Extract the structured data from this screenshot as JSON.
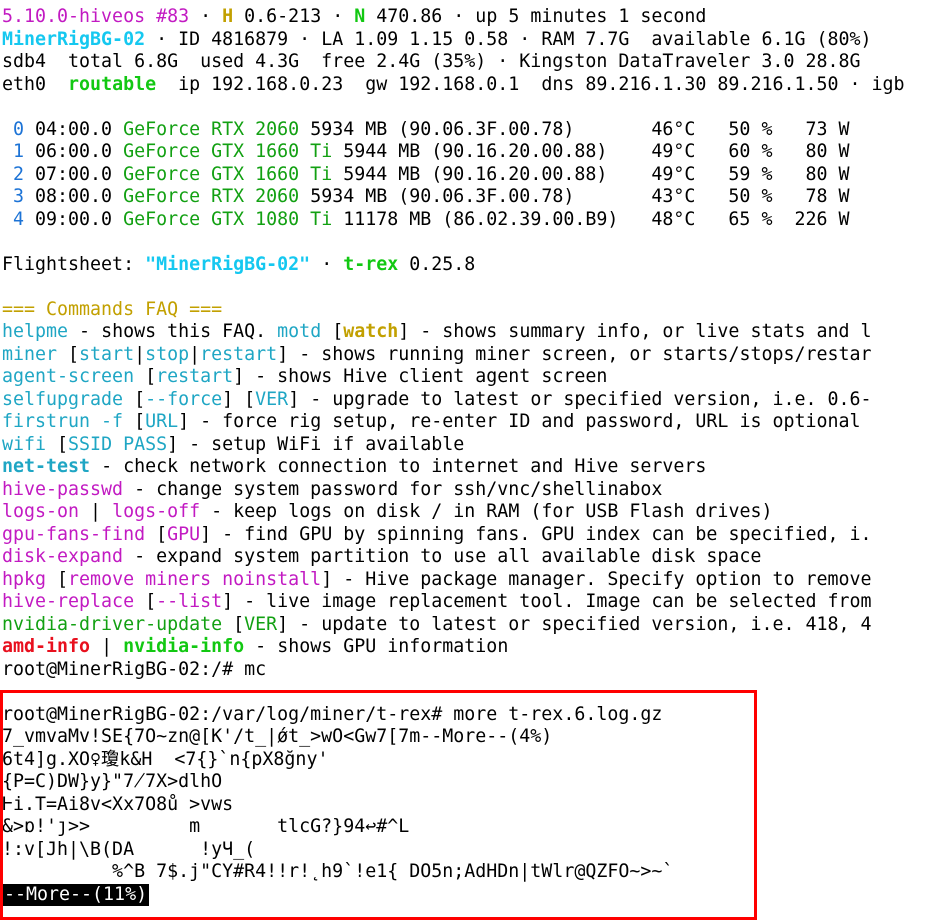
{
  "lines": [
    [
      [
        "5.10.0-hiveos #83",
        "c-magenta"
      ],
      [
        " · ",
        ""
      ],
      [
        "H",
        "c-byellow"
      ],
      [
        " 0.6-213 · ",
        ""
      ],
      [
        "N",
        "c-bgreen"
      ],
      [
        " 470.86 · up 5 minutes 1 second",
        ""
      ]
    ],
    [
      [
        "MinerRigBG-02",
        "c-bcyan"
      ],
      [
        " · ID 4816879 · LA 1.09 1.15 0.58 · RAM 7.7G  available 6.1G (80%)",
        ""
      ]
    ],
    [
      [
        "sdb4  total 6.8G  used 4.3G  free 2.4G (35%) · Kingston DataTraveler 3.0 28.8G",
        ""
      ]
    ],
    [
      [
        "eth0  ",
        ""
      ],
      [
        "routable",
        "c-bgreen"
      ],
      [
        "  ip 192.168.0.23  gw 192.168.0.1  dns 89.216.1.30 89.216.1.50 · igb",
        ""
      ]
    ],
    [
      [
        "",
        ""
      ]
    ],
    [
      [
        " 0",
        "c-blue"
      ],
      [
        " 04:00.0 ",
        ""
      ],
      [
        "GeForce RTX 2060",
        "c-green"
      ],
      [
        " 5934 MB (90.06.3F.00.78)       46°C   50 %   73 W",
        ""
      ]
    ],
    [
      [
        " 1",
        "c-blue"
      ],
      [
        " 06:00.0 ",
        ""
      ],
      [
        "GeForce GTX 1660 Ti",
        "c-green"
      ],
      [
        " 5944 MB (90.16.20.00.88)    49°C   60 %   80 W",
        ""
      ]
    ],
    [
      [
        " 2",
        "c-blue"
      ],
      [
        " 07:00.0 ",
        ""
      ],
      [
        "GeForce GTX 1660 Ti",
        "c-green"
      ],
      [
        " 5944 MB (90.16.20.00.88)    49°C   59 %   80 W",
        ""
      ]
    ],
    [
      [
        " 3",
        "c-blue"
      ],
      [
        " 08:00.0 ",
        ""
      ],
      [
        "GeForce RTX 2060",
        "c-green"
      ],
      [
        " 5934 MB (90.06.3F.00.78)       43°C   50 %   78 W",
        ""
      ]
    ],
    [
      [
        " 4",
        "c-blue"
      ],
      [
        " 09:00.0 ",
        ""
      ],
      [
        "GeForce GTX 1080 Ti",
        "c-green"
      ],
      [
        " 11178 MB (86.02.39.00.B9)   48°C   65 %  226 W",
        ""
      ]
    ],
    [
      [
        "",
        ""
      ]
    ],
    [
      [
        "Flightsheet: ",
        ""
      ],
      [
        "\"MinerRigBG-02\"",
        "c-bcyan"
      ],
      [
        " · ",
        ""
      ],
      [
        "t-rex",
        "c-bgreen"
      ],
      [
        " 0.25.8",
        ""
      ]
    ],
    [
      [
        "",
        ""
      ]
    ],
    [
      [
        "=== Commands FAQ ===",
        "c-yellow"
      ]
    ],
    [
      [
        "helpme",
        "c-cyan"
      ],
      [
        " - shows this FAQ. ",
        ""
      ],
      [
        "motd",
        "c-cyan"
      ],
      [
        " [",
        ""
      ],
      [
        "watch",
        "c-byellow"
      ],
      [
        "] - shows summary info, or live stats and l",
        ""
      ]
    ],
    [
      [
        "miner",
        "c-cyan"
      ],
      [
        " [",
        ""
      ],
      [
        "start",
        "c-cyan"
      ],
      [
        "|",
        ""
      ],
      [
        "stop",
        "c-cyan"
      ],
      [
        "|",
        ""
      ],
      [
        "restart",
        "c-cyan"
      ],
      [
        "] - shows running miner screen, or starts/stops/restar",
        ""
      ]
    ],
    [
      [
        "agent-screen",
        "c-cyan"
      ],
      [
        " [",
        ""
      ],
      [
        "restart",
        "c-cyan"
      ],
      [
        "] - shows Hive client agent screen",
        ""
      ]
    ],
    [
      [
        "selfupgrade",
        "c-cyan"
      ],
      [
        " [",
        ""
      ],
      [
        "--force",
        "c-cyan"
      ],
      [
        "] [",
        ""
      ],
      [
        "VER",
        "c-cyan"
      ],
      [
        "] - upgrade to latest or specified version, i.e. 0.6-",
        ""
      ]
    ],
    [
      [
        "firstrun -f",
        "c-cyan"
      ],
      [
        " [",
        ""
      ],
      [
        "URL",
        "c-cyan"
      ],
      [
        "] - force rig setup, re-enter ID and password, URL is optional",
        ""
      ]
    ],
    [
      [
        "wifi",
        "c-cyan"
      ],
      [
        " [",
        ""
      ],
      [
        "SSID PASS",
        "c-cyan"
      ],
      [
        "] - setup WiFi if available",
        ""
      ]
    ],
    [
      [
        "net-test",
        "c-cyan bold"
      ],
      [
        " - check network connection to internet and Hive servers",
        ""
      ]
    ],
    [
      [
        "hive-passwd",
        "c-magenta"
      ],
      [
        " - change system password for ssh/vnc/shellinabox",
        ""
      ]
    ],
    [
      [
        "logs-on",
        "c-magenta"
      ],
      [
        " | ",
        ""
      ],
      [
        "logs-off",
        "c-magenta"
      ],
      [
        " - keep logs on disk / in RAM (for USB Flash drives)",
        ""
      ]
    ],
    [
      [
        "gpu-fans-find",
        "c-magenta"
      ],
      [
        " [",
        ""
      ],
      [
        "GPU",
        "c-magenta"
      ],
      [
        "] - find GPU by spinning fans. GPU index can be specified, i.",
        ""
      ]
    ],
    [
      [
        "disk-expand",
        "c-magenta"
      ],
      [
        " - expand system partition to use all available disk space",
        ""
      ]
    ],
    [
      [
        "hpkg",
        "c-magenta"
      ],
      [
        " [",
        ""
      ],
      [
        "remove miners noinstall",
        "c-magenta"
      ],
      [
        "] - Hive package manager. Specify option to remove",
        ""
      ]
    ],
    [
      [
        "hive-replace",
        "c-magenta"
      ],
      [
        " [",
        ""
      ],
      [
        "--list",
        "c-magenta"
      ],
      [
        "] - live image replacement tool. Image can be selected from",
        ""
      ]
    ],
    [
      [
        "nvidia-driver-update",
        "c-green"
      ],
      [
        " [",
        ""
      ],
      [
        "VER",
        "c-green"
      ],
      [
        "] - update to latest or specified version, i.e. 418, 4",
        ""
      ]
    ],
    [
      [
        "amd-info",
        "c-bred"
      ],
      [
        " | ",
        ""
      ],
      [
        "nvidia-info",
        "c-bgreen"
      ],
      [
        " - shows GPU information",
        ""
      ]
    ],
    [
      [
        "root@MinerRigBG-02:/# mc",
        ""
      ]
    ],
    [
      [
        "",
        ""
      ]
    ],
    [
      [
        "root@MinerRigBG-02:/var/log/miner/t-rex# more t-rex.6.log.gz",
        ""
      ]
    ],
    [
      [
        "7_vmvaMv!SE{7O~zn@[K'/t_|ǿt_>wO<Gw7[7m--More--(4%)",
        ""
      ]
    ],
    [
      [
        "6t4]g.XO♀瓊k&H  <7{}`n{pX8ğny'",
        ""
      ]
    ],
    [
      [
        "{P=C)DW}y}\"7̸7X>dlhO",
        ""
      ]
    ],
    [
      [
        "Ⱶi.T=Ai8v<Xx7O8ů >vws",
        ""
      ]
    ],
    [
      [
        "&>ɒ!'ȷ>>         m       tlcG?}94↩#^L",
        ""
      ]
    ],
    [
      [
        "!:v[Jh|\\B(DA      !yЧ_(",
        ""
      ]
    ],
    [
      [
        "          %^B 7$.j\"CY#R4!!r!˛h9`!e1{ DO5n;AdHDn|tWlr@QZFO~>~`",
        ""
      ]
    ]
  ],
  "pager_status": "--More--(11%)"
}
